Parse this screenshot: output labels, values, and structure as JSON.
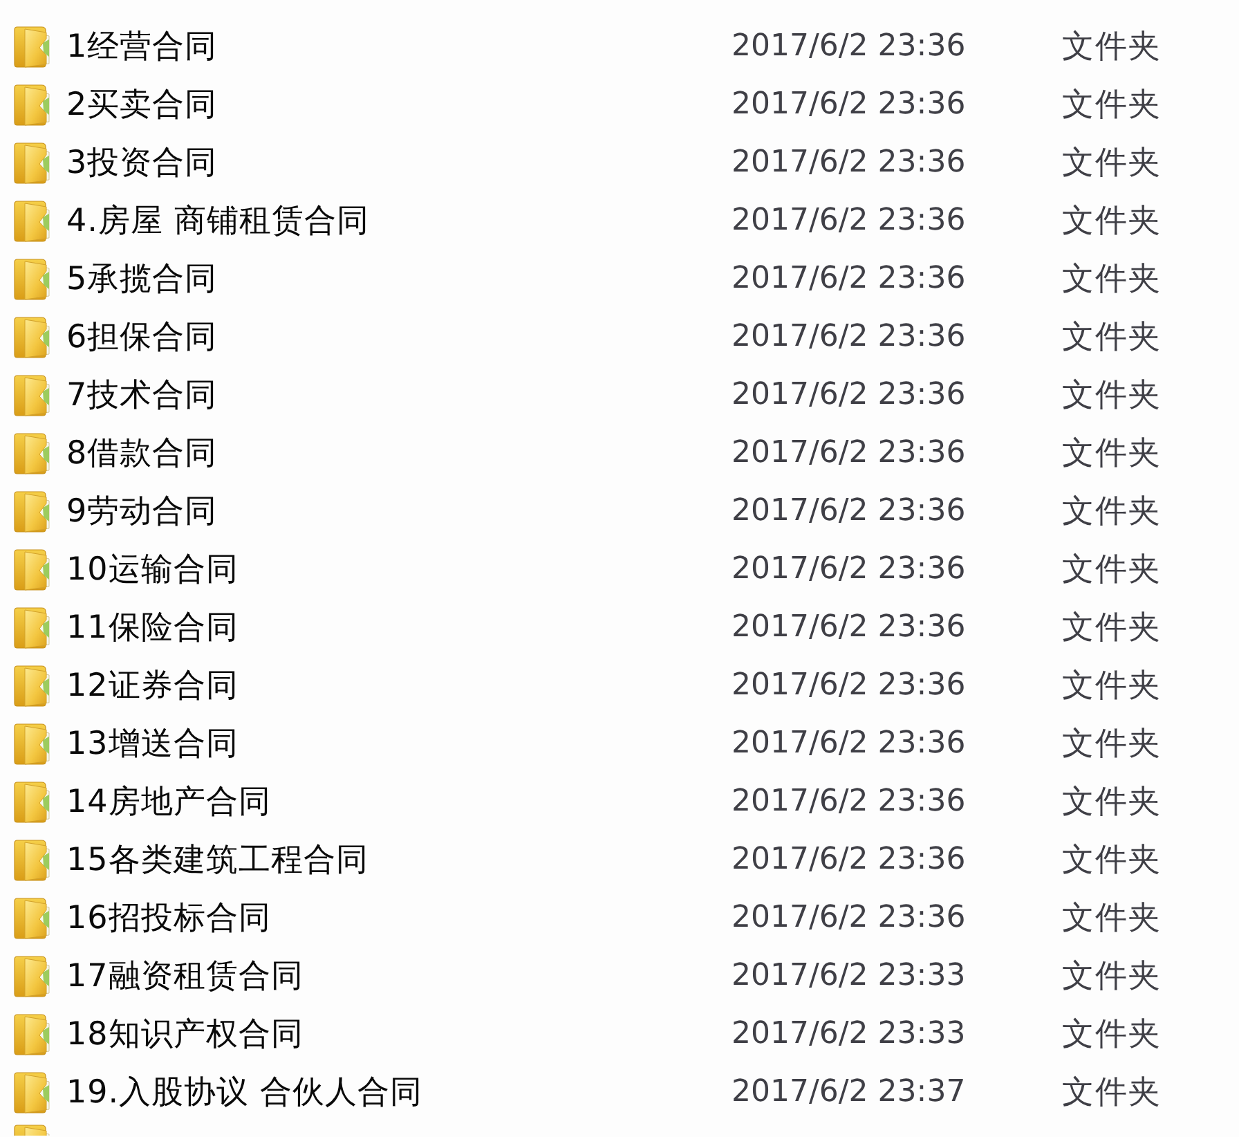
{
  "rows": [
    {
      "name": "1经营合同",
      "modified": "2017/6/2 23:36",
      "type": "文件夹"
    },
    {
      "name": "2买卖合同",
      "modified": "2017/6/2 23:36",
      "type": "文件夹"
    },
    {
      "name": "3投资合同",
      "modified": "2017/6/2 23:36",
      "type": "文件夹"
    },
    {
      "name": "4.房屋 商铺租赁合同",
      "modified": "2017/6/2 23:36",
      "type": "文件夹"
    },
    {
      "name": "5承揽合同",
      "modified": "2017/6/2 23:36",
      "type": "文件夹"
    },
    {
      "name": "6担保合同",
      "modified": "2017/6/2 23:36",
      "type": "文件夹"
    },
    {
      "name": "7技术合同",
      "modified": "2017/6/2 23:36",
      "type": "文件夹"
    },
    {
      "name": "8借款合同",
      "modified": "2017/6/2 23:36",
      "type": "文件夹"
    },
    {
      "name": "9劳动合同",
      "modified": "2017/6/2 23:36",
      "type": "文件夹"
    },
    {
      "name": "10运输合同",
      "modified": "2017/6/2 23:36",
      "type": "文件夹"
    },
    {
      "name": "11保险合同",
      "modified": "2017/6/2 23:36",
      "type": "文件夹"
    },
    {
      "name": "12证券合同",
      "modified": "2017/6/2 23:36",
      "type": "文件夹"
    },
    {
      "name": "13增送合同",
      "modified": "2017/6/2 23:36",
      "type": "文件夹"
    },
    {
      "name": "14房地产合同",
      "modified": "2017/6/2 23:36",
      "type": "文件夹"
    },
    {
      "name": "15各类建筑工程合同",
      "modified": "2017/6/2 23:36",
      "type": "文件夹"
    },
    {
      "name": "16招投标合同",
      "modified": "2017/6/2 23:36",
      "type": "文件夹"
    },
    {
      "name": "17融资租赁合同",
      "modified": "2017/6/2 23:33",
      "type": "文件夹"
    },
    {
      "name": "18知识产权合同",
      "modified": "2017/6/2 23:33",
      "type": "文件夹"
    },
    {
      "name": "19.入股协议 合伙人合同",
      "modified": "2017/6/2 23:37",
      "type": "文件夹"
    }
  ],
  "more_rows_below": true
}
